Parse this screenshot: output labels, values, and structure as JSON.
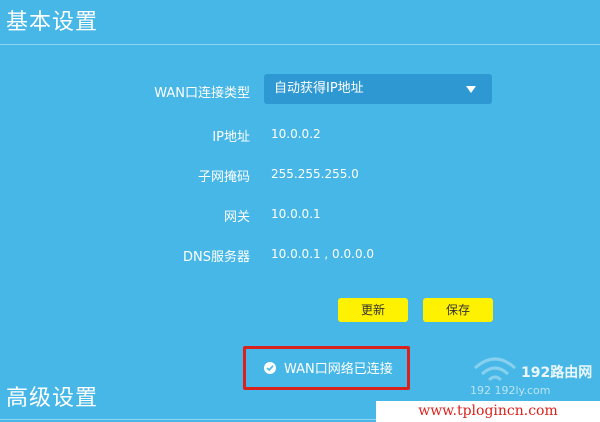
{
  "sections": {
    "basic": "基本设置",
    "advanced": "高级设置"
  },
  "wan": {
    "type_label": "WAN口连接类型",
    "type_value": "自动获得IP地址",
    "ip_label": "IP地址",
    "ip_value": "10.0.0.2",
    "mask_label": "子网掩码",
    "mask_value": "255.255.255.0",
    "gateway_label": "网关",
    "gateway_value": "10.0.0.1",
    "dns_label": "DNS服务器",
    "dns_value": "10.0.0.1 , 0.0.0.0"
  },
  "buttons": {
    "refresh": "更新",
    "save": "保存"
  },
  "status": {
    "text": "WAN口网络已连接"
  },
  "watermark": {
    "logo": "192路由网",
    "sub": "192      192ly.com",
    "url": "www.tplogincn.com"
  },
  "colors": {
    "background": "#46b7e6",
    "select": "#2e98d2",
    "button": "#fff200",
    "highlight": "#d9221c"
  }
}
